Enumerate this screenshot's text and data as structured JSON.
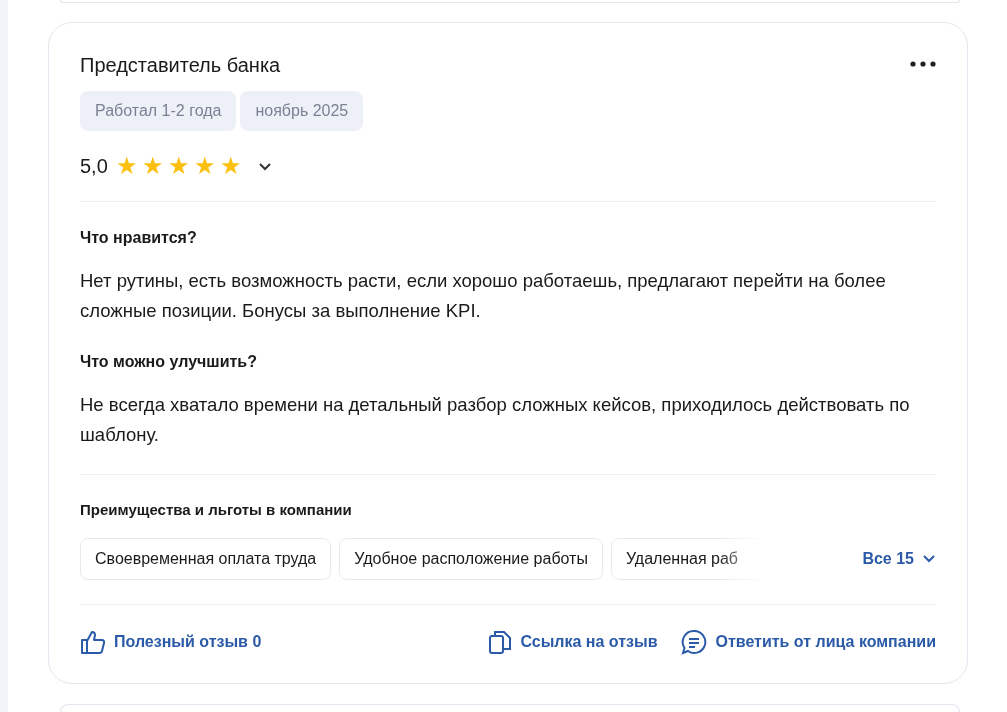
{
  "review": {
    "title": "Представитель банка",
    "tags": [
      "Работал 1-2 года",
      "ноябрь 2025"
    ],
    "rating": "5,0",
    "stars": 5,
    "sections": [
      {
        "heading": "Что нравится?",
        "text": "Нет рутины, есть возможность расти, если хорошо работаешь, предлагают перейти на более сложные позиции. Бонусы за выполнение KPI."
      },
      {
        "heading": "Что можно улучшить?",
        "text": "Не всегда хватало времени на детальный разбор сложных кейсов, приходилось действовать по шаблону."
      }
    ],
    "benefits": {
      "heading": "Преимущества и льготы в компании",
      "items": [
        "Своевременная оплата труда",
        "Удобное расположение работы",
        "Удаленная раб"
      ],
      "more": "Все 15"
    },
    "actions": [
      {
        "kind": "like",
        "label": "Полезный отзыв 0"
      },
      {
        "kind": "link",
        "label": "Ссылка на отзыв"
      },
      {
        "kind": "reply",
        "label": "Ответить от лица компании"
      }
    ]
  }
}
